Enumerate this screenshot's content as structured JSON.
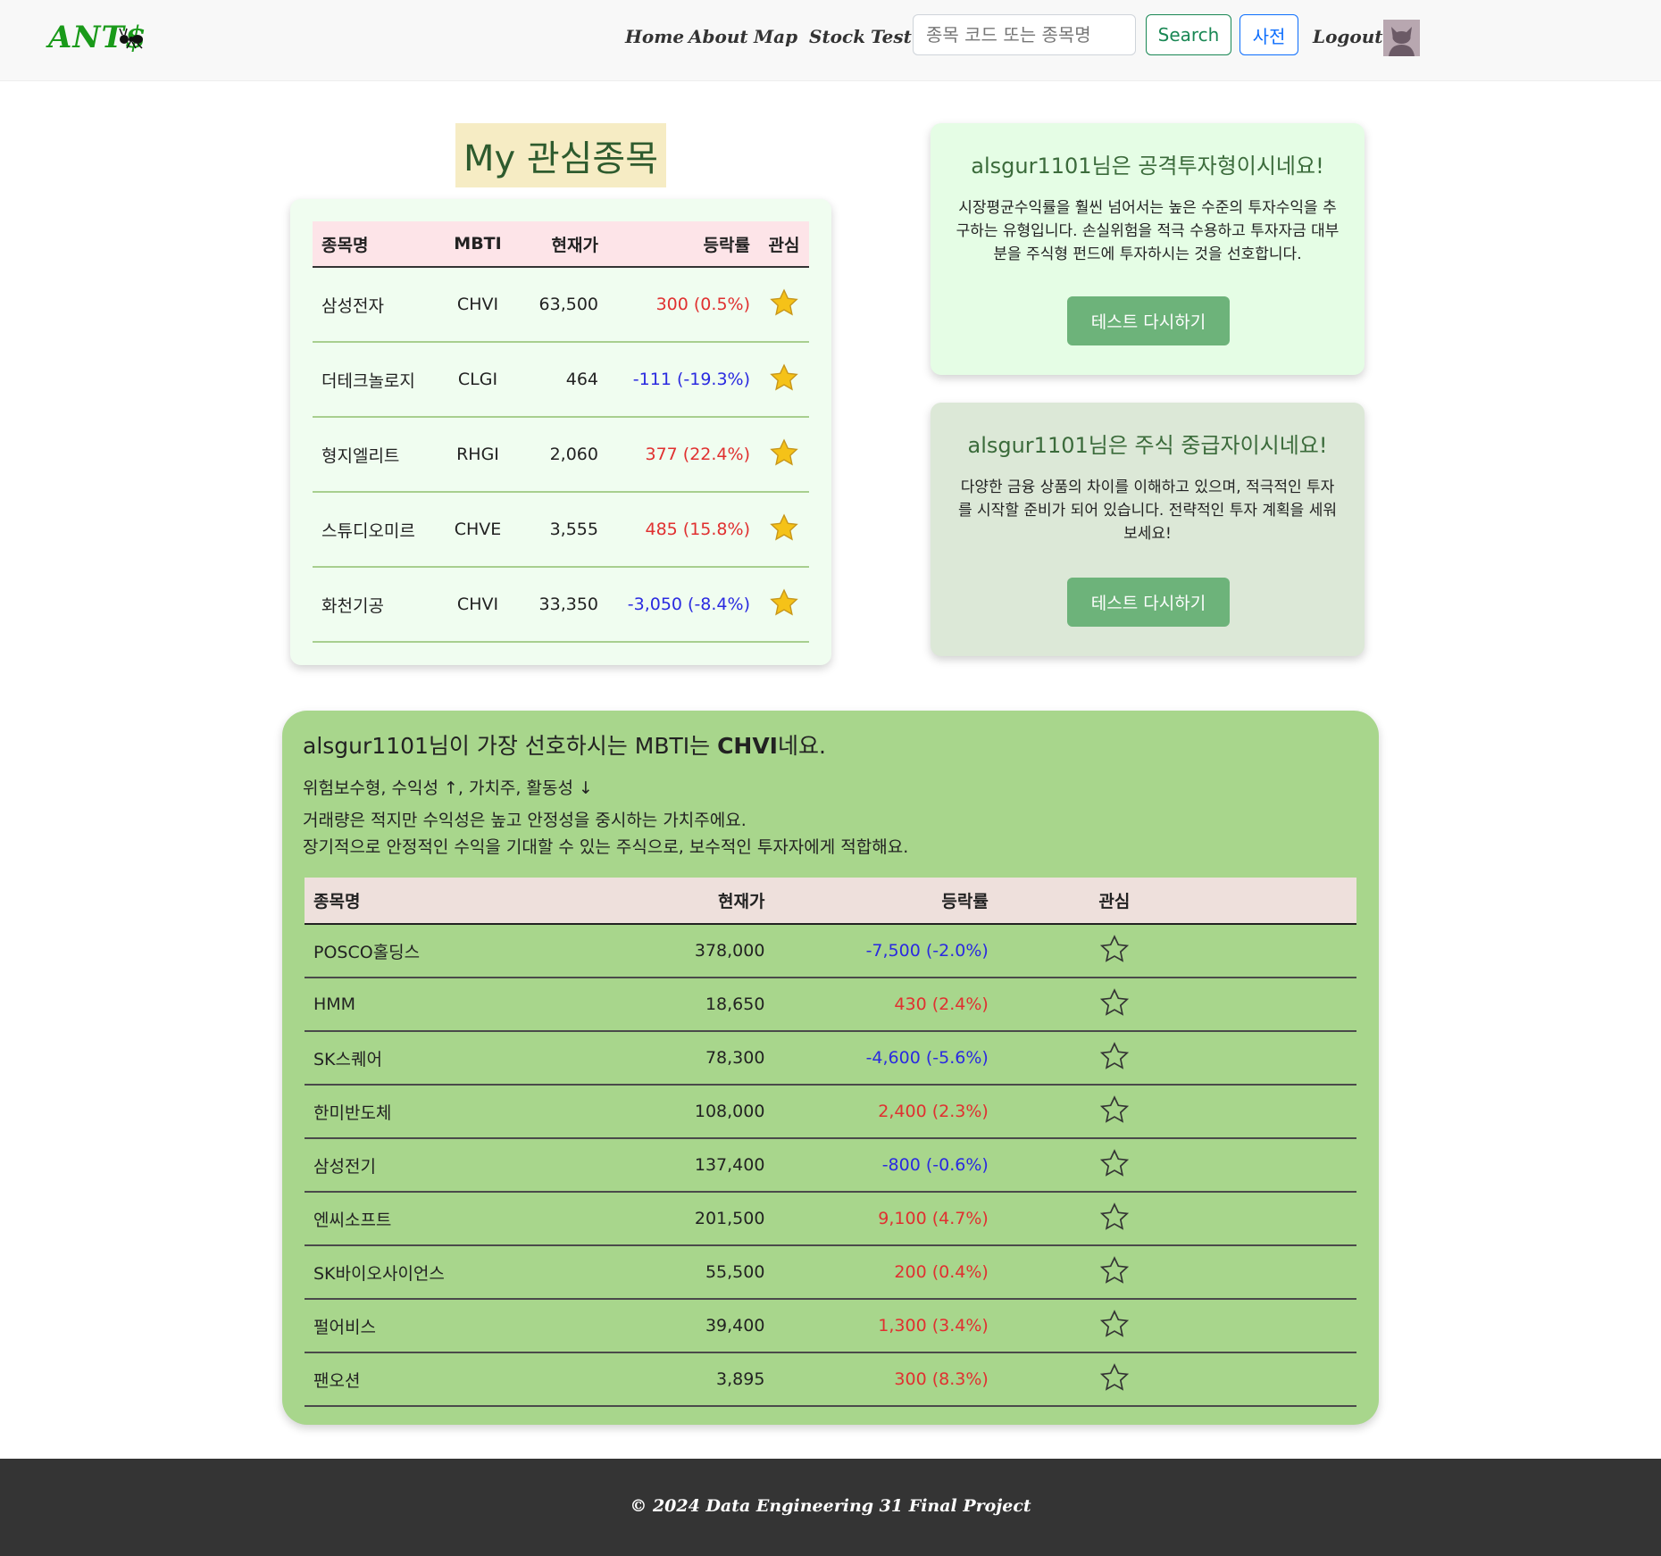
{
  "nav": {
    "logo": "ANT$",
    "links": [
      "Home",
      "About",
      "Map",
      "Stock",
      "Test"
    ],
    "search_placeholder": "종목 코드 또는 종목명",
    "search_button": "Search",
    "dict_button": "사전",
    "logout": "Logout"
  },
  "watchlist": {
    "title": "My 관심종목",
    "headers": [
      "종목명",
      "MBTI",
      "현재가",
      "등락률",
      "관심"
    ],
    "rows": [
      {
        "name": "삼성전자",
        "mbti": "CHVI",
        "price": "63,500",
        "change": "300 (0.5%)",
        "dir": "up"
      },
      {
        "name": "더테크놀로지",
        "mbti": "CLGI",
        "price": "464",
        "change": "-111 (-19.3%)",
        "dir": "down"
      },
      {
        "name": "형지엘리트",
        "mbti": "RHGI",
        "price": "2,060",
        "change": "377 (22.4%)",
        "dir": "up"
      },
      {
        "name": "스튜디오미르",
        "mbti": "CHVE",
        "price": "3,555",
        "change": "485 (15.8%)",
        "dir": "up"
      },
      {
        "name": "화천기공",
        "mbti": "CHVI",
        "price": "33,350",
        "change": "-3,050 (-8.4%)",
        "dir": "down"
      }
    ]
  },
  "test_cards": [
    {
      "title": "alsgur1101님은 공격투자형이시네요!",
      "desc": "시장평균수익률을 훨씬 넘어서는 높은 수준의 투자수익을 추구하는 유형입니다. 손실위험을 적극 수용하고 투자자금 대부분을 주식형 펀드에 투자하시는 것을 선호합니다.",
      "button": "테스트 다시하기"
    },
    {
      "title": "alsgur1101님은 주식 중급자이시네요!",
      "desc": "다양한 금융 상품의 차이를 이해하고 있으며, 적극적인 투자를 시작할 준비가 되어 있습니다. 전략적인 투자 계획을 세워보세요!",
      "button": "테스트 다시하기"
    }
  ],
  "mbti": {
    "heading_prefix": "alsgur1101님이 가장 선호하시는 MBTI는 ",
    "heading_code": "CHVI",
    "heading_suffix": "네요.",
    "tags": "위험보수형, 수익성 ↑, 가치주, 활동성 ↓",
    "desc_line1": "거래량은 적지만 수익성은 높고 안정성을 중시하는 가치주에요.",
    "desc_line2": "장기적으로 안정적인 수익을 기대할 수 있는 주식으로, 보수적인 투자자에게 적합해요.",
    "headers": [
      "종목명",
      "현재가",
      "등락률",
      "관심"
    ],
    "rows": [
      {
        "name": "POSCO홀딩스",
        "price": "378,000",
        "change": "-7,500 (-2.0%)",
        "dir": "down"
      },
      {
        "name": "HMM",
        "price": "18,650",
        "change": "430 (2.4%)",
        "dir": "up"
      },
      {
        "name": "SK스퀘어",
        "price": "78,300",
        "change": "-4,600 (-5.6%)",
        "dir": "down"
      },
      {
        "name": "한미반도체",
        "price": "108,000",
        "change": "2,400 (2.3%)",
        "dir": "up"
      },
      {
        "name": "삼성전기",
        "price": "137,400",
        "change": "-800 (-0.6%)",
        "dir": "down"
      },
      {
        "name": "엔씨소프트",
        "price": "201,500",
        "change": "9,100 (4.7%)",
        "dir": "up"
      },
      {
        "name": "SK바이오사이언스",
        "price": "55,500",
        "change": "200 (0.4%)",
        "dir": "up"
      },
      {
        "name": "펄어비스",
        "price": "39,400",
        "change": "1,300 (3.4%)",
        "dir": "up"
      },
      {
        "name": "팬오션",
        "price": "3,895",
        "change": "300 (8.3%)",
        "dir": "up"
      }
    ]
  },
  "footer": "© 2024 Data Engineering 31 Final Project",
  "colors": {
    "up": "#e03030",
    "down": "#2a2ae0",
    "brand": "#1a9a1a"
  },
  "icons": {
    "filled_star": "star-filled-icon",
    "empty_star": "star-outline-icon",
    "ant": "ant-icon",
    "avatar": "user-avatar-icon"
  }
}
